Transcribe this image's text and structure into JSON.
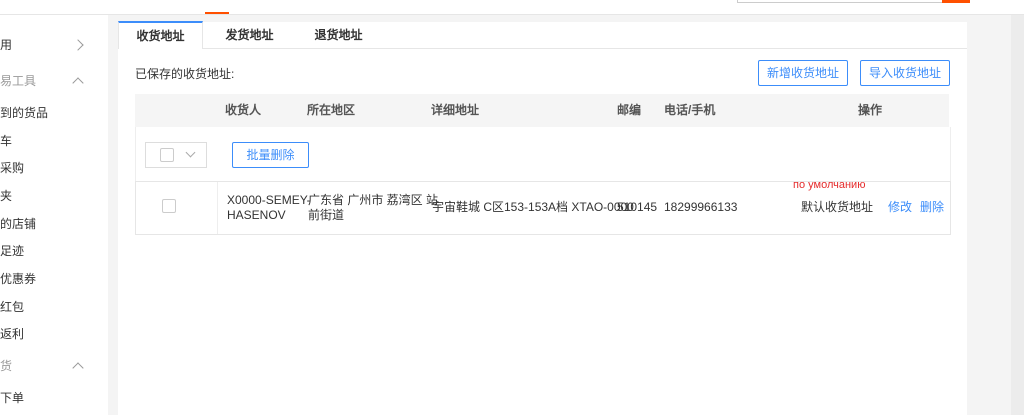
{
  "sidebar": {
    "items": [
      {
        "label": "用",
        "type": "item",
        "chevron": "right"
      },
      {
        "label": "易工具",
        "type": "group",
        "chevron": "up"
      },
      {
        "label": "到的货品",
        "type": "item"
      },
      {
        "label": "车",
        "type": "item"
      },
      {
        "label": "采购",
        "type": "item"
      },
      {
        "label": "夹",
        "type": "item"
      },
      {
        "label": "的店铺",
        "type": "item"
      },
      {
        "label": "足迹",
        "type": "item"
      },
      {
        "label": "优惠券",
        "type": "item"
      },
      {
        "label": "红包",
        "type": "item"
      },
      {
        "label": "返利",
        "type": "item"
      },
      {
        "label": "货",
        "type": "group",
        "chevron": "up"
      },
      {
        "label": "下单",
        "type": "item"
      }
    ]
  },
  "tabs": [
    {
      "label": "收货地址",
      "active": true
    },
    {
      "label": "发货地址",
      "active": false
    },
    {
      "label": "退货地址",
      "active": false
    }
  ],
  "saved_label": "已保存的收货地址:",
  "buttons": {
    "add_address": "新增收货地址",
    "import_address": "导入收货地址",
    "batch_delete": "批量删除"
  },
  "table": {
    "headers": {
      "receiver": "收货人",
      "region": "所在地区",
      "address": "详细地址",
      "zip": "邮编",
      "phone": "电话/手机",
      "actions": "操作"
    },
    "rows": [
      {
        "receiver_line1": "X0000-SEMEY-",
        "receiver_line2": "HASENOV",
        "region_line1": "广东省 广州市 荔湾区 站",
        "region_line2": "前街道",
        "address": "宇宙鞋城 C区153-153A档 XTAO-0000",
        "zip": "510145",
        "phone": "18299966133",
        "default_label": "默认收货地址",
        "default_note": "по умолчанию",
        "edit": "修改",
        "delete": "删除"
      }
    ]
  },
  "colors": {
    "accent": "#3c8dfa",
    "brand": "#ff5000",
    "note": "#e52b2b"
  }
}
